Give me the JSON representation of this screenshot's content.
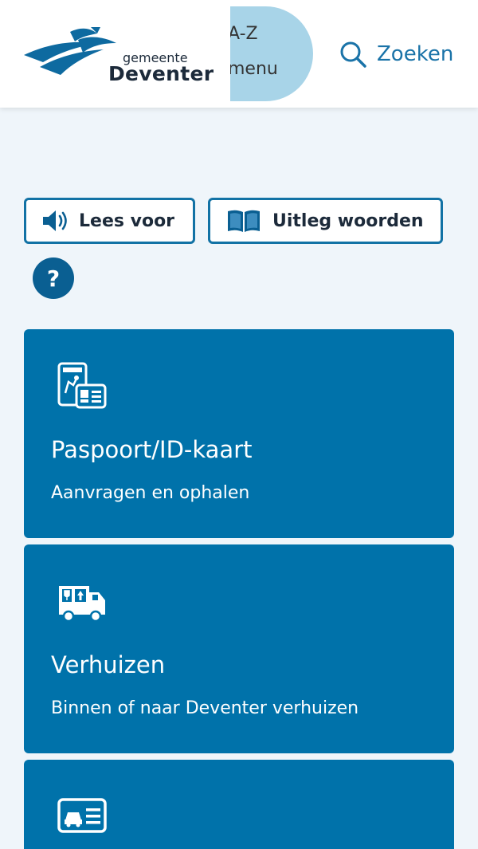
{
  "header": {
    "logo": {
      "line1": "gemeente",
      "line2": "Deventer"
    },
    "az_menu": {
      "line1": "A-Z",
      "line2": "menu"
    },
    "search": {
      "label": "Zoeken",
      "icon": "search-icon"
    }
  },
  "tools": {
    "read_aloud": {
      "label": "Lees voor",
      "icon": "speaker-icon"
    },
    "explain_words": {
      "label": "Uitleg woorden",
      "icon": "book-icon"
    },
    "help": {
      "label": "?",
      "icon": "question-icon"
    }
  },
  "cards": [
    {
      "title": "Paspoort/ID-kaart",
      "subtitle": "Aanvragen en ophalen",
      "icon": "passport-id-icon"
    },
    {
      "title": "Verhuizen",
      "subtitle": "Binnen of naar Deventer verhuizen",
      "icon": "moving-truck-icon"
    },
    {
      "title": "",
      "subtitle": "",
      "icon": "driver-license-icon"
    }
  ],
  "colors": {
    "brand_blue": "#0072aa",
    "dark_blue": "#0a5f92",
    "accent_blue": "#1a73a8",
    "light_blue": "#a8d4e8",
    "page_background": "#eff5fa"
  }
}
